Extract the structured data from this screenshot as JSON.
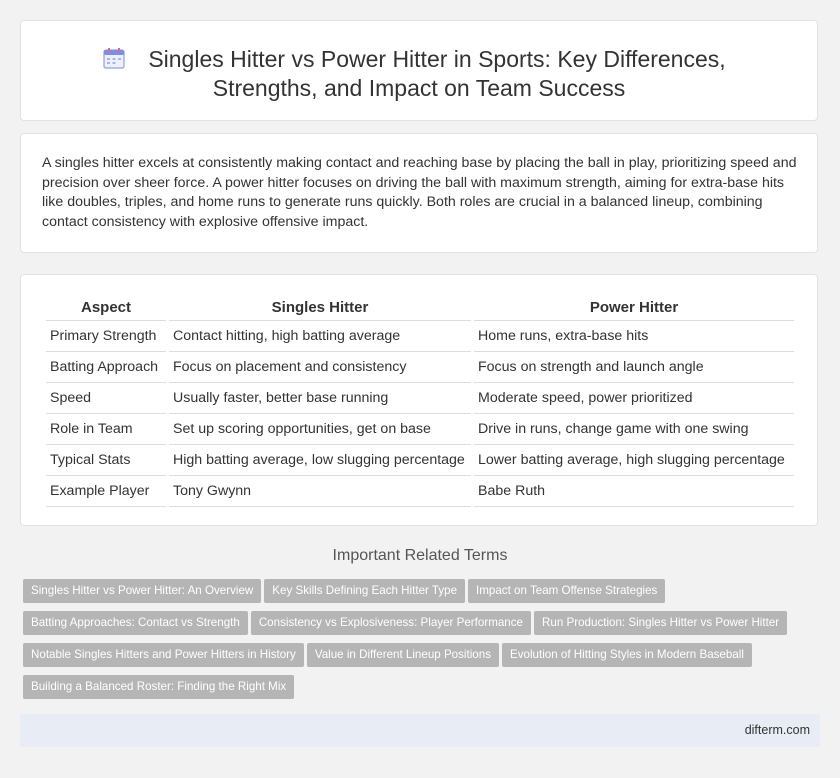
{
  "header": {
    "title_line1": "Singles Hitter vs Power Hitter in Sports: Key Differences,",
    "title_line2": "Strengths, and Impact on Team Success",
    "icon": "calendar-icon"
  },
  "intro": "A singles hitter excels at consistently making contact and reaching base by placing the ball in play, prioritizing speed and precision over sheer force. A power hitter focuses on driving the ball with maximum strength, aiming for extra-base hits like doubles, triples, and home runs to generate runs quickly. Both roles are crucial in a balanced lineup, combining contact consistency with explosive offensive impact.",
  "table": {
    "headers": [
      "Aspect",
      "Singles Hitter",
      "Power Hitter"
    ],
    "rows": [
      [
        "Primary Strength",
        "Contact hitting, high batting average",
        "Home runs, extra-base hits"
      ],
      [
        "Batting Approach",
        "Focus on placement and consistency",
        "Focus on strength and launch angle"
      ],
      [
        "Speed",
        "Usually faster, better base running",
        "Moderate speed, power prioritized"
      ],
      [
        "Role in Team",
        "Set up scoring opportunities, get on base",
        "Drive in runs, change game with one swing"
      ],
      [
        "Typical Stats",
        "High batting average, low slugging percentage",
        "Lower batting average, high slugging percentage"
      ],
      [
        "Example Player",
        "Tony Gwynn",
        "Babe Ruth"
      ]
    ]
  },
  "related": {
    "title": "Important Related Terms",
    "tags": [
      "Singles Hitter vs Power Hitter: An Overview",
      "Key Skills Defining Each Hitter Type",
      "Impact on Team Offense Strategies",
      "Batting Approaches: Contact vs Strength",
      "Consistency vs Explosiveness: Player Performance",
      "Run Production: Singles Hitter vs Power Hitter",
      "Notable Singles Hitters and Power Hitters in History",
      "Value in Different Lineup Positions",
      "Evolution of Hitting Styles in Modern Baseball",
      "Building a Balanced Roster: Finding the Right Mix"
    ]
  },
  "footer": {
    "site": "difterm.com"
  }
}
